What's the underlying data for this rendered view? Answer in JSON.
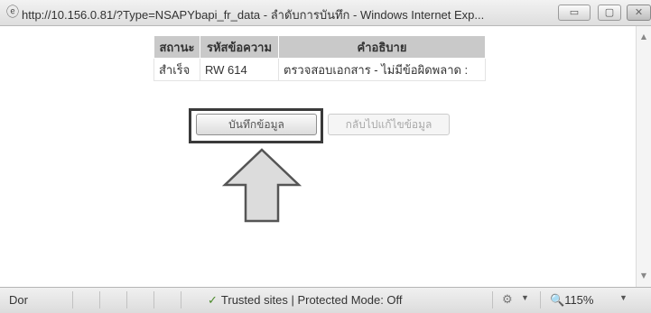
{
  "window": {
    "title": "http://10.156.0.81/?Type=NSAPYbapi_fr_data - ลำดับการบันทึก - Windows Internet Exp...",
    "min_label": "▭",
    "max_label": "▢",
    "close_label": "✕"
  },
  "table": {
    "headers": [
      "สถานะ",
      "รหัสข้อความ",
      "คำอธิบาย"
    ],
    "rows": [
      [
        "สำเร็จ",
        "RW 614",
        "ตรวจสอบเอกสาร - ไม่มีข้อผิดพลาด :"
      ]
    ]
  },
  "buttons": {
    "save": "บันทึกข้อมูล",
    "back": "กลับไปแก้ไขข้อมูล"
  },
  "status": {
    "text": "Dor",
    "trusted": "Trusted sites | Protected Mode: Off",
    "zoom": "115%"
  },
  "icons": {
    "browser": "ie-icon",
    "check": "check-icon",
    "security": "security-icon",
    "zoom": "zoom-icon",
    "arrow": "arrow-up-icon"
  },
  "colors": {
    "header_bg": "#c9c9c9",
    "arrow_fill": "#dcdcdc",
    "arrow_stroke": "#555555"
  }
}
